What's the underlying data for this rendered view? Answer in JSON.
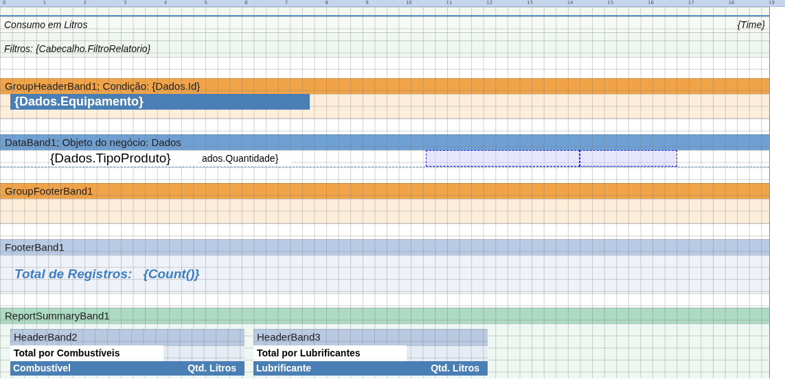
{
  "ruler": [
    "0",
    "1",
    "2",
    "3",
    "4",
    "5",
    "6",
    "7",
    "8",
    "9",
    "10",
    "11",
    "12",
    "13",
    "14",
    "15",
    "16",
    "17",
    "18",
    "19"
  ],
  "page_header": {
    "title": "Consumo em Litros",
    "time": "{Time}"
  },
  "filter_text": "Filtros: {Cabecalho.FiltroRelatorio}",
  "bands": [
    {
      "kind": "group_header",
      "title": "GroupHeaderBand1; Condição: {Dados.Id}",
      "field": "{Dados.Equipamento}"
    },
    {
      "kind": "data",
      "title": "DataBand1; Objeto do negócio: Dados",
      "cells": [
        {
          "text": "{Dados.TipoProduto}",
          "selected": false
        },
        {
          "text": "ados.Quantidade}",
          "selected": false
        },
        {
          "selected": true
        },
        {
          "selected": true
        }
      ]
    },
    {
      "kind": "group_footer",
      "title": "GroupFooterBand1"
    },
    {
      "kind": "footer",
      "title": "FooterBand1",
      "label": "Total de Registros:",
      "value": "{Count()}"
    },
    {
      "kind": "summary",
      "title": "ReportSummaryBand1",
      "panels": [
        {
          "title": "HeaderBand2",
          "caption": "Total por Combustíveis",
          "columns": [
            "Combustível",
            "Qtd. Litros"
          ]
        },
        {
          "title": "HeaderBand3",
          "caption": "Total por Lubrificantes",
          "columns": [
            "Lubrificante",
            "Qtd. Litros"
          ]
        }
      ]
    }
  ]
}
